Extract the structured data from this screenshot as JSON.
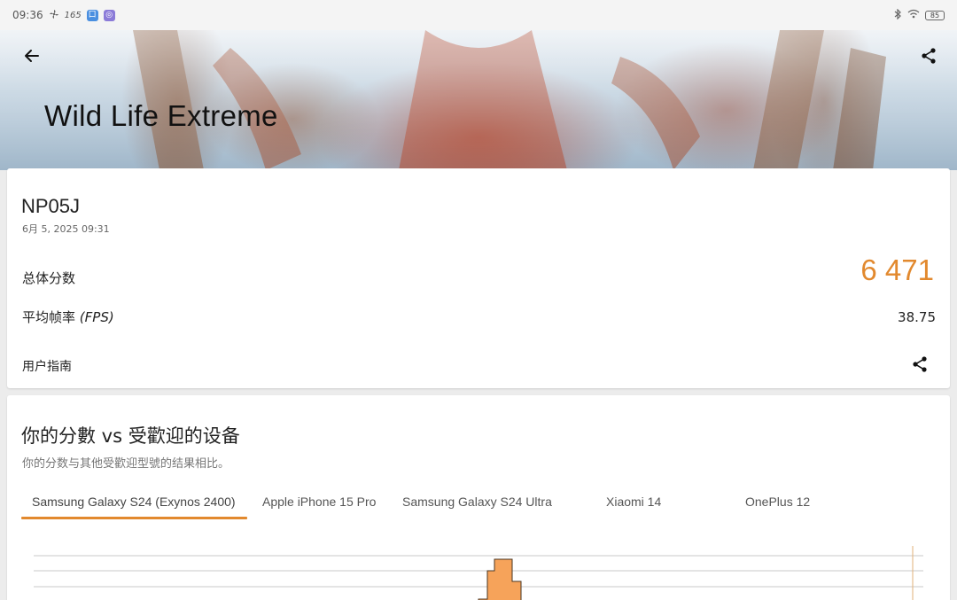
{
  "status_bar": {
    "time": "09:36",
    "refresh_rate": "165",
    "battery": "85",
    "icons": [
      "fan-icon",
      "app-badge-blue",
      "app-badge-purple",
      "bluetooth-icon",
      "wifi-icon",
      "battery-icon"
    ]
  },
  "header": {
    "title": "Wild Life Extreme",
    "back_icon": "arrow-left-icon",
    "share_icon": "share-icon"
  },
  "result": {
    "device_name": "NP05J",
    "date": "6月 5, 2025 09:31",
    "total_score_label": "总体分数",
    "total_score_value": "6 471",
    "fps_label": "平均帧率",
    "fps_unit": "(FPS)",
    "fps_value": "38.75",
    "guide_label": "用户指南"
  },
  "comparison": {
    "title": "你的分數 vs 受歡迎的设备",
    "subtitle": "你的分数与其他受歡迎型號的结果相比。",
    "tabs": [
      {
        "label": "Samsung Galaxy S24 (Exynos 2400)",
        "active": true
      },
      {
        "label": "Apple iPhone 15 Pro",
        "active": false
      },
      {
        "label": "Samsung Galaxy S24 Ultra",
        "active": false
      },
      {
        "label": "Xiaomi 14",
        "active": false
      },
      {
        "label": "OnePlus 12",
        "active": false
      }
    ]
  },
  "colors": {
    "accent": "#e2892e",
    "histogram_fill": "#f6a35a",
    "text_primary": "#1e1e1e",
    "text_secondary": "#777777"
  }
}
